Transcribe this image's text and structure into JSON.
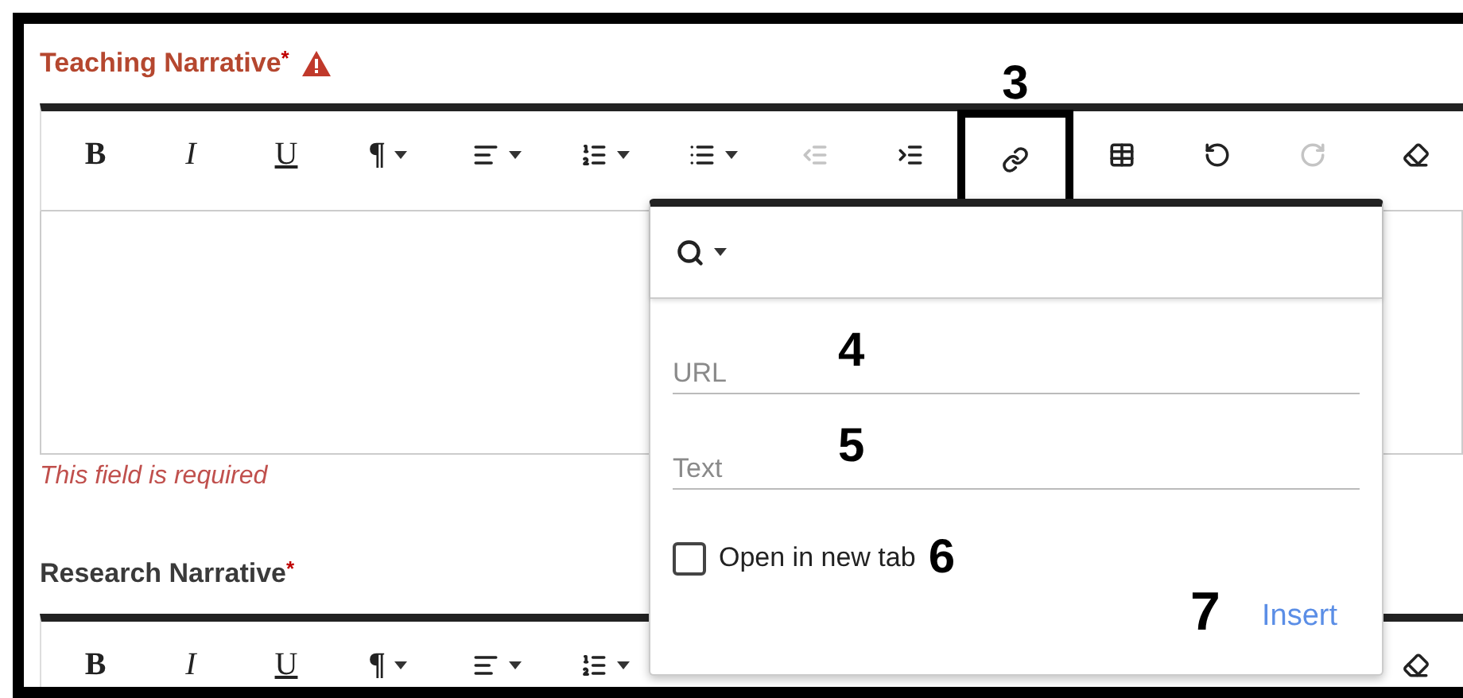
{
  "fields": [
    {
      "label": "Teaching Narrative",
      "required_mark": "*",
      "warning": true,
      "error": "This field is required",
      "toolbar": [
        {
          "kind": "bold",
          "label": "B",
          "dropdown": false,
          "disabled": false
        },
        {
          "kind": "italic",
          "label": "I",
          "dropdown": false,
          "disabled": false
        },
        {
          "kind": "underline",
          "label": "U",
          "dropdown": false,
          "disabled": false
        },
        {
          "kind": "paragraph",
          "label": "¶",
          "dropdown": true,
          "disabled": false
        },
        {
          "kind": "align",
          "dropdown": true,
          "disabled": false
        },
        {
          "kind": "ordered-list",
          "dropdown": true,
          "disabled": false
        },
        {
          "kind": "bullet-list",
          "dropdown": true,
          "disabled": false
        },
        {
          "kind": "outdent",
          "dropdown": false,
          "disabled": true
        },
        {
          "kind": "indent",
          "dropdown": false,
          "disabled": false
        },
        {
          "kind": "link",
          "dropdown": false,
          "disabled": false,
          "callout": "3"
        },
        {
          "kind": "table",
          "dropdown": false,
          "disabled": false
        },
        {
          "kind": "undo",
          "dropdown": false,
          "disabled": false
        },
        {
          "kind": "redo",
          "dropdown": false,
          "disabled": true
        },
        {
          "kind": "eraser",
          "dropdown": false,
          "disabled": false
        }
      ]
    },
    {
      "label": "Research Narrative",
      "required_mark": "*",
      "warning": false,
      "toolbar": [
        {
          "kind": "bold",
          "label": "B",
          "dropdown": false,
          "disabled": false
        },
        {
          "kind": "italic",
          "label": "I",
          "dropdown": false,
          "disabled": false
        },
        {
          "kind": "underline",
          "label": "U",
          "dropdown": false,
          "disabled": false
        },
        {
          "kind": "paragraph",
          "label": "¶",
          "dropdown": true,
          "disabled": false
        },
        {
          "kind": "align",
          "dropdown": true,
          "disabled": false
        },
        {
          "kind": "ordered-list",
          "dropdown": true,
          "disabled": false
        },
        {
          "kind": "eraser",
          "dropdown": false,
          "disabled": false
        }
      ]
    }
  ],
  "link_popover": {
    "url": {
      "placeholder": "URL",
      "callout": "4"
    },
    "text": {
      "placeholder": "Text",
      "callout": "5"
    },
    "new_tab": {
      "label": "Open in new tab",
      "checked": false,
      "callout": "6"
    },
    "insert": {
      "label": "Insert",
      "callout": "7"
    }
  }
}
